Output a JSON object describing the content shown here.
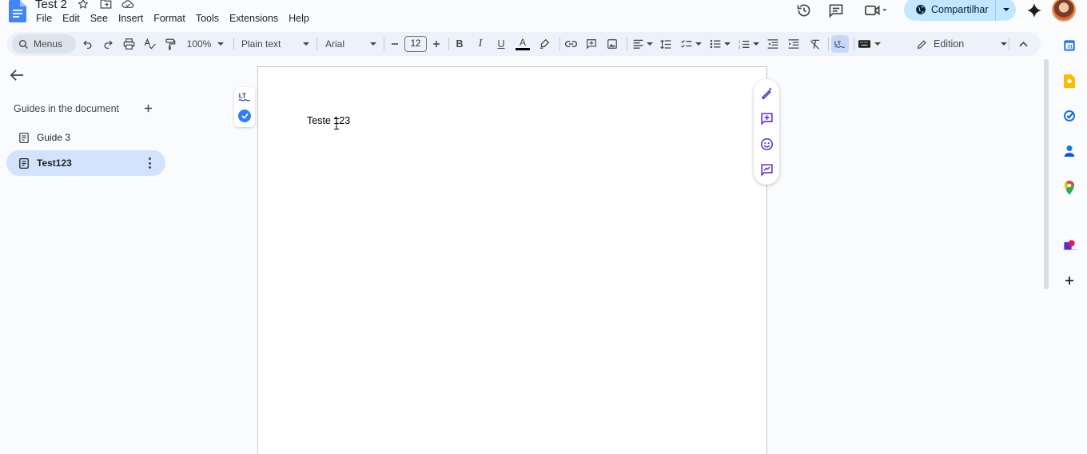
{
  "app": {
    "doc_title": "Test 2",
    "menu": [
      "File",
      "Edit",
      "See",
      "Insert",
      "Format",
      "Tools",
      "Extensions",
      "Help"
    ]
  },
  "header": {
    "share_label": "Compartilhar"
  },
  "toolbar": {
    "search_label": "Menus",
    "zoom": "100%",
    "style": "Plain text",
    "font": "Arial",
    "font_size": "12",
    "bold": "B",
    "italic": "I",
    "underline": "U",
    "text_color": "A",
    "mode": "Edition"
  },
  "outline": {
    "heading": "Guides in the document",
    "items": [
      {
        "label": "Guide 3",
        "active": false
      },
      {
        "label": "Test123",
        "active": true
      }
    ]
  },
  "document": {
    "body_text": "Teste 123"
  },
  "colors": {
    "accent": "#0b57d0",
    "share_bg": "#c2e7ff",
    "toolbar_bg": "#edf2fa",
    "active_item_bg": "#d3e3fd",
    "lt_check": "#2d7ff9",
    "float_icon": "#5b2fd1"
  },
  "icons": {
    "top_right": [
      "history-icon",
      "comment-icon",
      "meet-icon",
      "globe-icon",
      "gemini-icon"
    ],
    "side_panel": [
      "calendar-icon",
      "keep-icon",
      "tasks-icon",
      "contacts-icon",
      "maps-icon",
      "addon-icon",
      "plus-icon"
    ],
    "float_actions": [
      "ai-edit-icon",
      "add-comment-icon",
      "emoji-icon",
      "suggest-icon"
    ]
  }
}
